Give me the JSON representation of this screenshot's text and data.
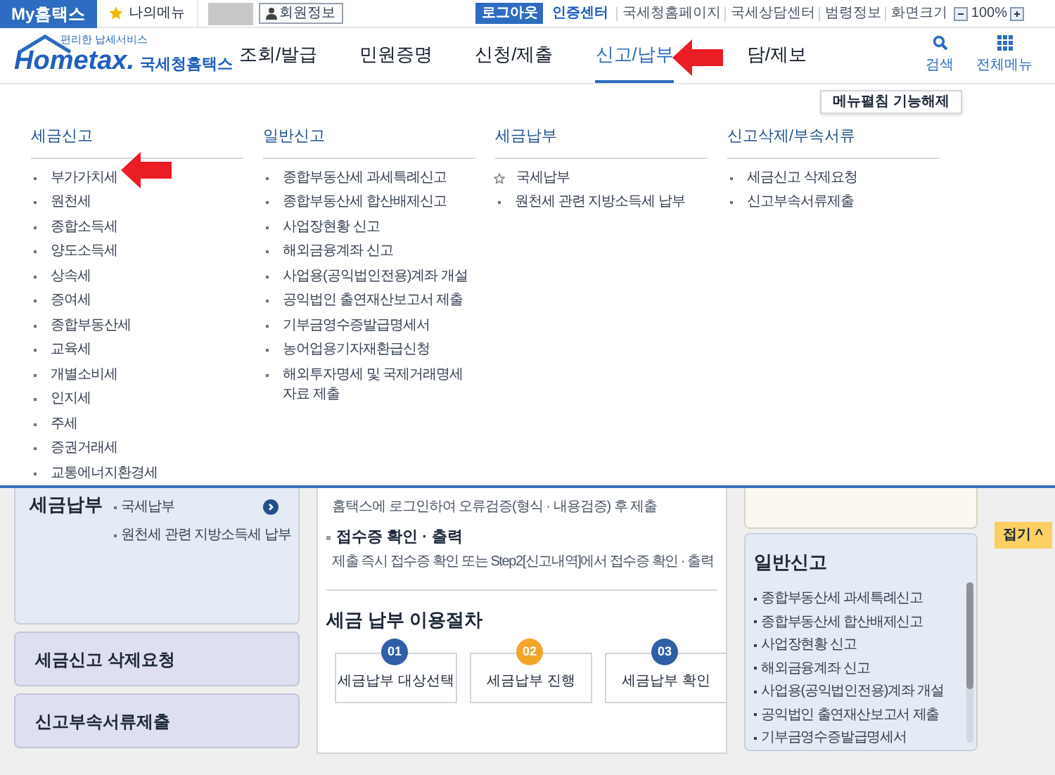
{
  "top_bar": {
    "my_hometax": "My홈택스",
    "my_menu": "나의메뉴",
    "member_info": "회원정보",
    "logout": "로그아웃",
    "links": [
      {
        "label": "인증센터",
        "highlighted": true
      },
      {
        "label": "국세청홈페이지",
        "highlighted": false
      },
      {
        "label": "국세상담센터",
        "highlighted": false
      },
      {
        "label": "범령정보",
        "highlighted": false
      },
      {
        "label": "화면크기",
        "highlighted": false
      }
    ],
    "zoom_value": "100%"
  },
  "header": {
    "logo": {
      "tagline": "편리한 납세서비스",
      "wordmark": "Hometax.",
      "name": "국세청홈택스"
    },
    "nav": [
      {
        "label": "조회/발급",
        "selected": false
      },
      {
        "label": "민원증명",
        "selected": false
      },
      {
        "label": "신청/제출",
        "selected": false
      },
      {
        "label": "신고/납부",
        "selected": true
      },
      {
        "label": "담/제보",
        "selected": false
      }
    ],
    "tools": [
      "검색",
      "전체메뉴"
    ]
  },
  "mega_menu": {
    "toggle_button": "메뉴펼침 기능해제",
    "columns": [
      {
        "title": "세금신고",
        "items": [
          {
            "label": "부가가치세",
            "kind": "dot"
          },
          {
            "label": "원천세",
            "kind": "dot"
          },
          {
            "label": "종합소득세",
            "kind": "dot"
          },
          {
            "label": "양도소득세",
            "kind": "dot"
          },
          {
            "label": "상속세",
            "kind": "dot"
          },
          {
            "label": "증여세",
            "kind": "dot"
          },
          {
            "label": "종합부동산세",
            "kind": "dot"
          },
          {
            "label": "교육세",
            "kind": "dot"
          },
          {
            "label": "개별소비세",
            "kind": "dot"
          },
          {
            "label": "인지세",
            "kind": "dot"
          },
          {
            "label": "주세",
            "kind": "dot"
          },
          {
            "label": "증권거래세",
            "kind": "dot"
          },
          {
            "label": "교통에너지환경세",
            "kind": "dot"
          }
        ]
      },
      {
        "title": "일반신고",
        "items": [
          {
            "label": "종합부동산세 과세특례신고",
            "kind": "dot"
          },
          {
            "label": "종합부동산세 합산배제신고",
            "kind": "dot"
          },
          {
            "label": "사업장현황 신고",
            "kind": "dot"
          },
          {
            "label": "해외금융계좌 신고",
            "kind": "dot"
          },
          {
            "label": "사업용(공익법인전용)계좌 개설",
            "kind": "dot"
          },
          {
            "label": "공익법인 출연재산보고서 제출",
            "kind": "dot"
          },
          {
            "label": "기부금영수증발급명세서",
            "kind": "dot"
          },
          {
            "label": "농어업용기자재환급신청",
            "kind": "dot"
          },
          {
            "label": "해외투자명세 및 국제거래명세 자료 제출",
            "kind": "dot"
          }
        ]
      },
      {
        "title": "세금납부",
        "items": [
          {
            "label": "국세납부",
            "kind": "star"
          },
          {
            "label": "원천세 관련 지방소득세 납부",
            "kind": "dot"
          }
        ]
      },
      {
        "title": "신고삭제/부속서류",
        "items": [
          {
            "label": "세금신고 삭제요청",
            "kind": "dot"
          },
          {
            "label": "신고부속서류제출",
            "kind": "dot"
          }
        ]
      }
    ]
  },
  "left_panels": [
    {
      "title": "세금납부",
      "kind": "list",
      "items": [
        "국세납부",
        "원천세 관련 지방소득세 납부"
      ]
    },
    {
      "title": "세금신고 삭제요청",
      "kind": "link"
    },
    {
      "title": "신고부속서류제출",
      "kind": "link"
    }
  ],
  "guide": {
    "intro": "홈택스에 로그인하여 오류검증(형식 · 내용검증) 후 제출",
    "step_title": "접수증 확인 · 출력",
    "step_text": "제출 즉시 접수증 확인 또는 Step2[신고내역]에서 접수증 확인 · 출력",
    "procedure_title": "세금 납부 이용절차",
    "steps": [
      {
        "number": "01",
        "label": "세금납부 대상선택",
        "color": "#2f5fa6"
      },
      {
        "number": "02",
        "label": "세금납부 진행",
        "color": "#f5a42a"
      },
      {
        "number": "03",
        "label": "세금납부 확인",
        "color": "#2f5fa6"
      }
    ]
  },
  "side_panel": {
    "title": "일반신고",
    "items": [
      "종합부동산세 과세특례신고",
      "종합부동산세 합산배제신고",
      "사업장현황 신고",
      "해외금융계좌 신고",
      "사업용(공익법인전용)계좌 개설",
      "공익법인 출연재산보고서 제출",
      "기부금영수증발급명세서"
    ]
  },
  "fold_button": "접기 ^"
}
